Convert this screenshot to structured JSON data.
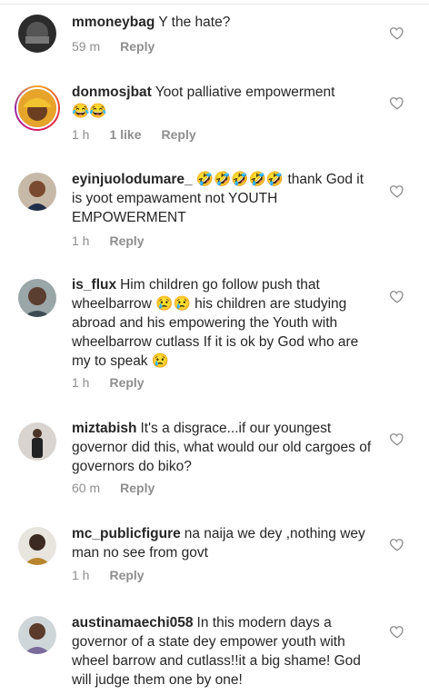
{
  "comments": [
    {
      "username": "mmoneybag",
      "text": "Y the  hate?",
      "time": "59 m",
      "likes": "",
      "reply": "Reply"
    },
    {
      "username": "donmosjbat",
      "text": "Yoot palliative empowerment",
      "trail_emoji": "😂😂",
      "time": "1 h",
      "likes": "1 like",
      "reply": "Reply"
    },
    {
      "username": "eyinjuolodumare_",
      "lead_emoji": "🤣🤣🤣🤣🤣",
      "text": "thank God it is yoot empawament not YOUTH EMPOWERMENT",
      "time": "1 h",
      "likes": "",
      "reply": "Reply"
    },
    {
      "username": "is_flux",
      "text_a": "Him children go follow push that wheelbarrow",
      "mid_emoji": "😢😢",
      "text_b": "his children are studying abroad and his empowering the Youth with wheelbarrow cutlass If it is ok by God who are my to speak",
      "trail_emoji": "😢",
      "time": "1 h",
      "likes": "",
      "reply": "Reply"
    },
    {
      "username": "miztabish",
      "text": "It's a disgrace...if our youngest governor did this, what would our old cargoes of governors do biko?",
      "time": "60 m",
      "likes": "",
      "reply": "Reply"
    },
    {
      "username": "mc_publicfigure",
      "text": "na naija we dey ,nothing wey man no see from govt",
      "time": "1 h",
      "likes": "",
      "reply": "Reply"
    },
    {
      "username": "austinamaechi058",
      "text": "In this modern days a governor of a state dey empower youth with wheel barrow and cutlass!!it a big shame! God will judge them one by one!",
      "time": "",
      "likes": "",
      "reply": ""
    }
  ],
  "icons": {
    "like": "heart-outline-icon"
  }
}
